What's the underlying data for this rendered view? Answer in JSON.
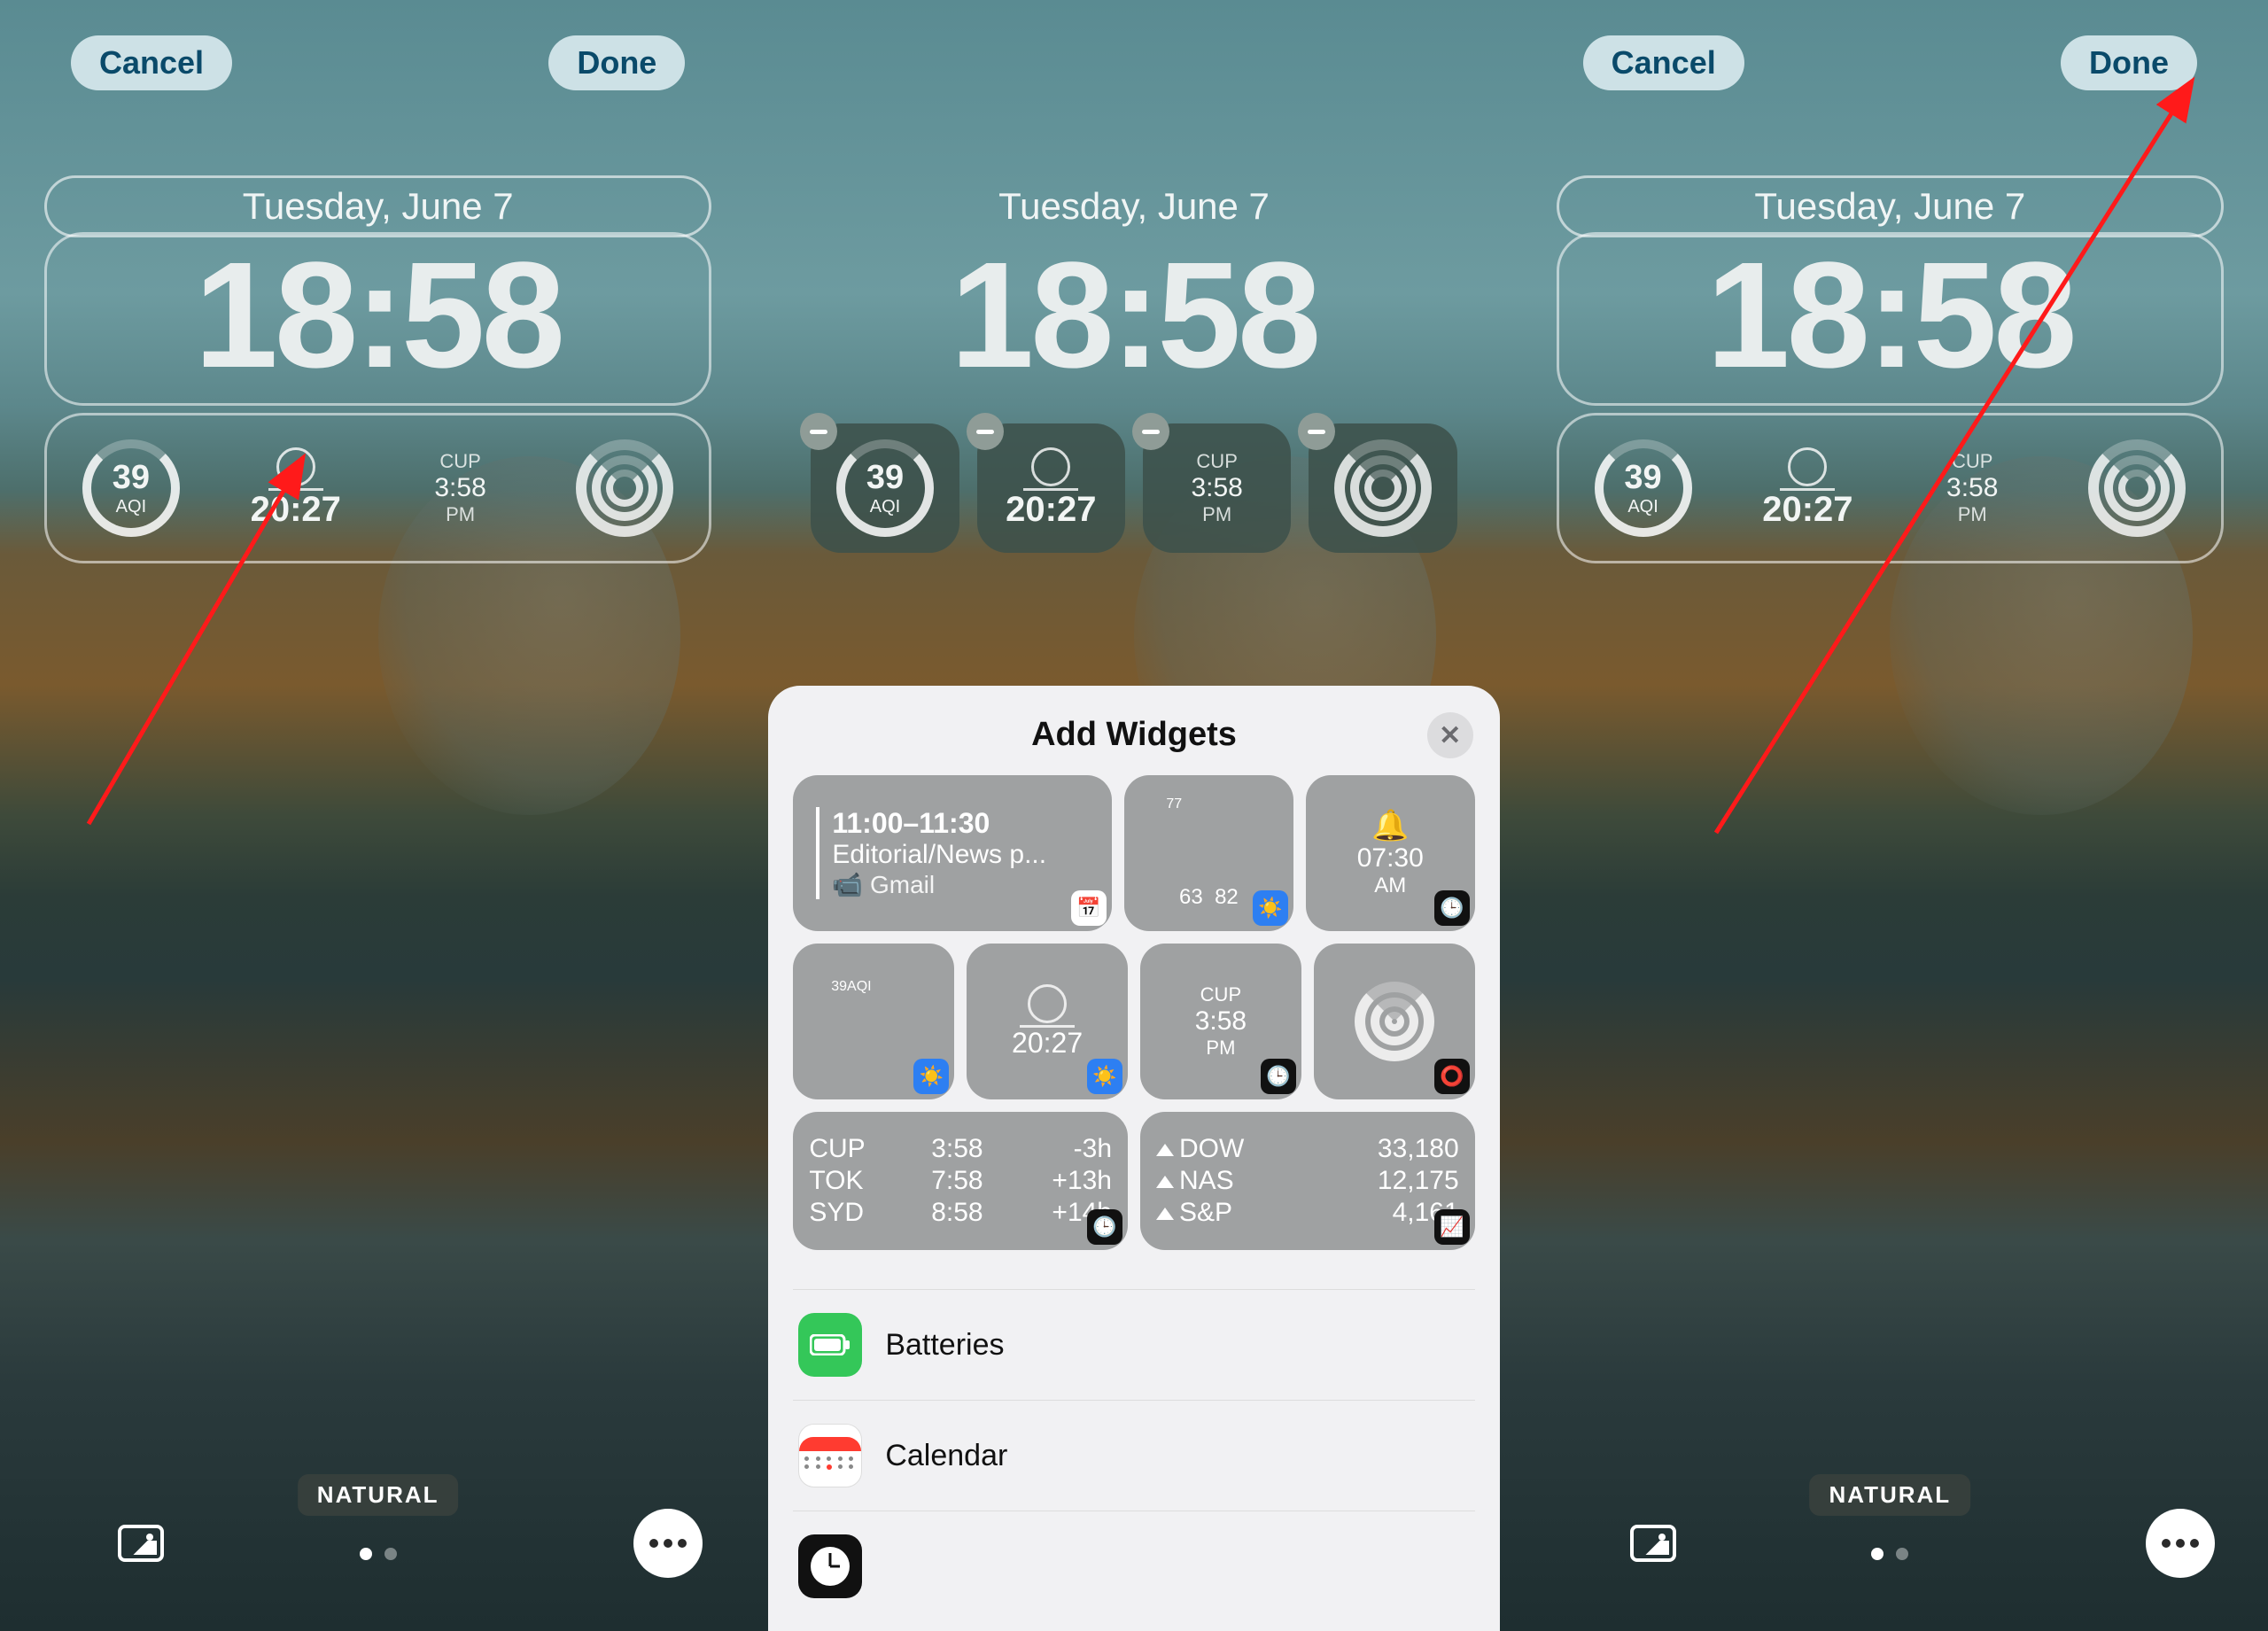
{
  "common": {
    "cancel": "Cancel",
    "done": "Done",
    "date": "Tuesday, June 7",
    "time": "18:58",
    "natural": "NATURAL"
  },
  "widgets": {
    "aqi": {
      "value": "39",
      "label": "AQI"
    },
    "sunset": {
      "time": "20:27"
    },
    "cup": {
      "label": "CUP",
      "time": "3:58",
      "ampm": "PM"
    }
  },
  "sheet": {
    "title": "Add Widgets",
    "calendar_event": {
      "time": "11:00–11:30",
      "title": "Editorial/News p...",
      "source": "Gmail",
      "icon": "📅"
    },
    "weather": {
      "temp": "77",
      "low": "63",
      "high": "82",
      "icon": "☀️"
    },
    "alarm": {
      "time": "07:30",
      "ampm": "AM",
      "icon": "⏰"
    },
    "aqi": {
      "value": "39",
      "label": "AQI"
    },
    "sunset": {
      "time": "20:27"
    },
    "cup": {
      "label": "CUP",
      "time": "3:58",
      "ampm": "PM"
    },
    "worldclock": {
      "rows": [
        {
          "city": "CUP",
          "time": "3:58",
          "offset": "-3h"
        },
        {
          "city": "TOK",
          "time": "7:58",
          "offset": "+13h"
        },
        {
          "city": "SYD",
          "time": "8:58",
          "offset": "+14h"
        }
      ]
    },
    "stocks": {
      "rows": [
        {
          "sym": "DOW",
          "val": "33,180"
        },
        {
          "sym": "NAS",
          "val": "12,175"
        },
        {
          "sym": "S&P",
          "val": "4,161"
        }
      ]
    }
  },
  "apps": {
    "batteries": "Batteries",
    "calendar": "Calendar"
  }
}
